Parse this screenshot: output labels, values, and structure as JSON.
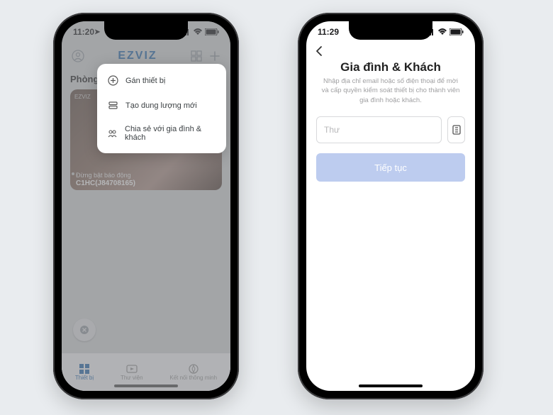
{
  "left": {
    "status": {
      "time": "11:20"
    },
    "header": {
      "brand": "EZVIZ",
      "profile_icon": "profile",
      "grid_icon": "grid",
      "add_icon": "plus"
    },
    "section_title": "Phòng khách",
    "card": {
      "watermark": "EZVIZ",
      "caption": "Đừng bật báo động",
      "model": "C1HC(J84708165)"
    },
    "dropdown": {
      "items": [
        {
          "icon": "plus-circle",
          "label": "Gán thiết bị"
        },
        {
          "icon": "stack",
          "label": "Tạo dung lượng mới"
        },
        {
          "icon": "share-people",
          "label": "Chia sẻ với gia đình & khách"
        }
      ]
    },
    "tabs": {
      "devices": "Thiết bị",
      "library": "Thư viện",
      "smart": "Kết nối thông minh"
    }
  },
  "right": {
    "status": {
      "time": "11:29"
    },
    "title": "Gia đình & Khách",
    "subtitle": "Nhập địa chỉ email hoặc số điện thoại để mời và cấp quyền kiểm soát thiết bị cho thành viên gia đình hoặc khách.",
    "input_placeholder": "Thư",
    "continue_label": "Tiếp tục"
  }
}
